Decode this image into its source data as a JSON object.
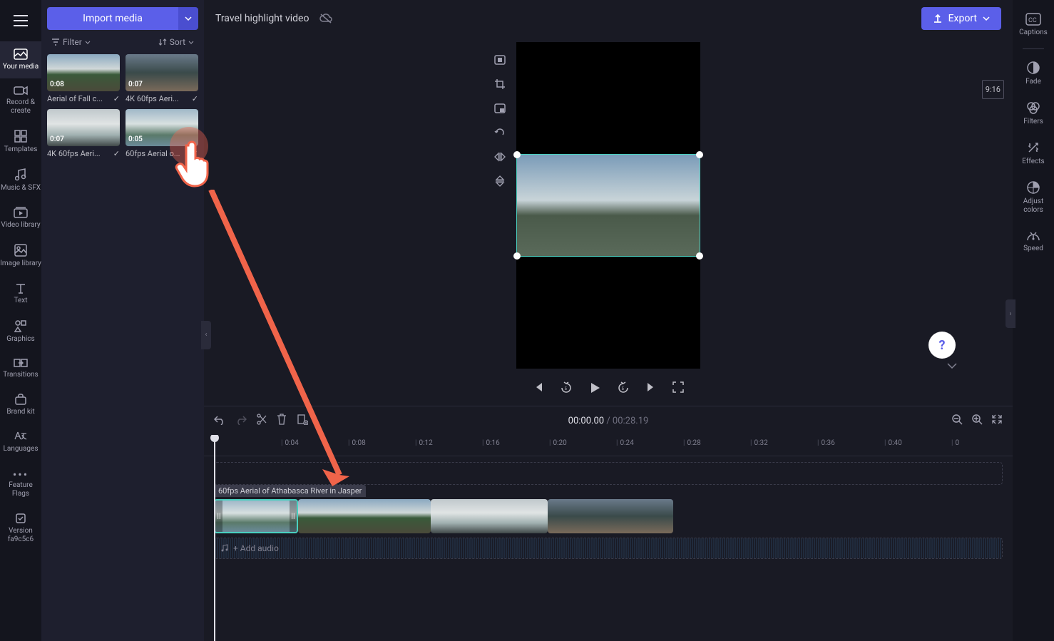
{
  "left_rail": {
    "items": [
      {
        "label": "Your media"
      },
      {
        "label": "Record & create"
      },
      {
        "label": "Templates"
      },
      {
        "label": "Music & SFX"
      },
      {
        "label": "Video library"
      },
      {
        "label": "Image library"
      },
      {
        "label": "Text"
      },
      {
        "label": "Graphics"
      },
      {
        "label": "Transitions"
      },
      {
        "label": "Brand kit"
      },
      {
        "label": "Languages"
      },
      {
        "label": "Feature Flags"
      },
      {
        "label": "Version fa9c5c6"
      }
    ]
  },
  "media_panel": {
    "import_label": "Import media",
    "filter_label": "Filter",
    "sort_label": "Sort",
    "items": [
      {
        "duration": "0:08",
        "name": "Aerial of Fall c..."
      },
      {
        "duration": "0:07",
        "name": "4K 60fps Aeri..."
      },
      {
        "duration": "0:07",
        "name": "4K 60fps Aeri..."
      },
      {
        "duration": "0:05",
        "name": "60fps Aerial o..."
      }
    ]
  },
  "top_bar": {
    "project_title": "Travel highlight video",
    "export_label": "Export"
  },
  "preview": {
    "aspect_badge": "9:16"
  },
  "timeline": {
    "current_time": "00:00.00",
    "total_time": "00:28.19",
    "ruler_ticks": [
      "0:04",
      "0:08",
      "0:12",
      "0:16",
      "0:20",
      "0:24",
      "0:28",
      "0:32",
      "0:36",
      "0:40",
      "0"
    ],
    "clip_label": "60fps Aerial of Athabasca River in Jasper",
    "add_audio_label": "+ Add audio"
  },
  "right_rail": {
    "items": [
      {
        "label": "Captions"
      },
      {
        "label": "Fade"
      },
      {
        "label": "Filters"
      },
      {
        "label": "Effects"
      },
      {
        "label": "Adjust colors"
      },
      {
        "label": "Speed"
      }
    ]
  },
  "help": {
    "symbol": "?"
  }
}
